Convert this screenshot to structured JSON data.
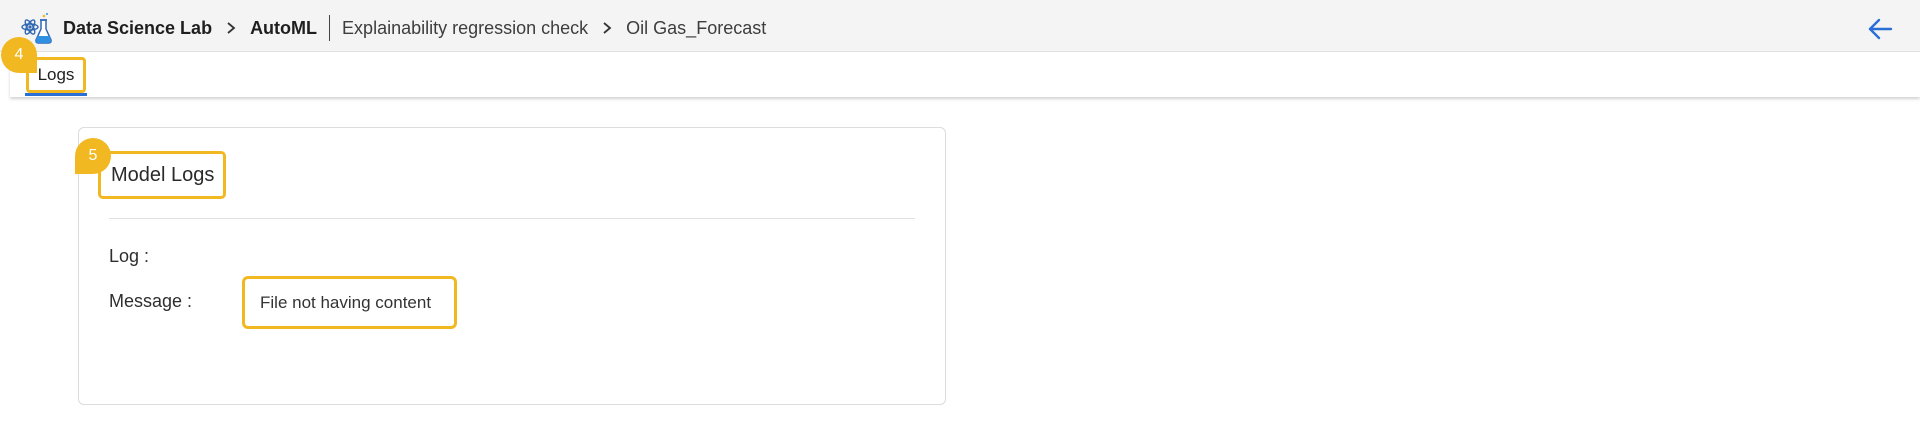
{
  "header": {
    "breadcrumb": {
      "workspace": "Data Science Lab",
      "module": "AutoML",
      "experiment": "Explainability regression check",
      "model": "Oil Gas_Forecast"
    },
    "logo_icon": "data-science-flask-icon",
    "back_icon": "arrow-left-icon",
    "accent_color": "#2a6fd6"
  },
  "tabs": {
    "items": [
      {
        "label": "Logs",
        "active": true
      }
    ]
  },
  "annotations": {
    "step_4": "4",
    "step_5": "5",
    "highlight_color": "#f2b822"
  },
  "card": {
    "title": "Model Logs",
    "log_label": "Log :",
    "message_label": "Message :",
    "message_value": "File not having content"
  }
}
